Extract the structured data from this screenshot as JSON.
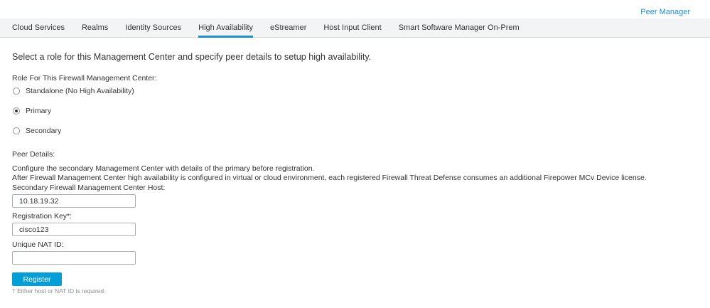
{
  "header": {
    "peer_manager_link": "Peer Manager"
  },
  "tabs": [
    {
      "label": "Cloud Services"
    },
    {
      "label": "Realms"
    },
    {
      "label": "Identity Sources"
    },
    {
      "label": "High Availability",
      "active": true
    },
    {
      "label": "eStreamer"
    },
    {
      "label": "Host Input Client"
    },
    {
      "label": "Smart Software Manager On-Prem"
    }
  ],
  "main": {
    "intro": "Select a role for this Management Center and specify peer details to setup high availability.",
    "role_label": "Role For This Firewall Management Center:",
    "roles": [
      {
        "label": "Standalone (No High Availability)",
        "checked": false
      },
      {
        "label": "Primary",
        "checked": true
      },
      {
        "label": "Secondary",
        "checked": false
      }
    ],
    "peer_details_label": "Peer Details:",
    "peer_desc_1": "Configure the secondary Management Center with details of the primary before registration.",
    "peer_desc_2": "After Firewall Management Center high availability is configured in virtual or cloud environment, each registered Firewall Threat Defense consumes an additional Firepower MCv Device license.",
    "host_label": "Secondary Firewall Management Center Host:",
    "host_value": "10.18.19.32",
    "key_label": "Registration Key*:",
    "key_value": "cisco123",
    "nat_label": "Unique NAT ID:",
    "nat_value": "",
    "register_button": "Register",
    "footnote": "† Either host or NAT ID is required."
  },
  "colors": {
    "accent": "#049fd9",
    "link": "#1a8fd6",
    "tab_bar_bg": "#f3f4f5"
  }
}
